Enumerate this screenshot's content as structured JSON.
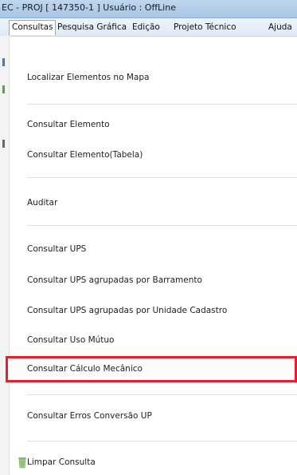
{
  "window": {
    "title": "EC - PROJ [ 147350-1 ] Usuário : OffLine"
  },
  "menubar": {
    "items": [
      {
        "label": "Consultas"
      },
      {
        "label": "Pesquisa Gráfica"
      },
      {
        "label": "Edição"
      },
      {
        "label": "Projeto Técnico"
      },
      {
        "label": "Ajuda"
      }
    ]
  },
  "dropdown": {
    "items": [
      {
        "label": "Localizar Elementos no Mapa"
      },
      {
        "label": "Consultar Elemento"
      },
      {
        "label": "Consultar Elemento(Tabela)"
      },
      {
        "label": "Auditar"
      },
      {
        "label": "Consultar UPS"
      },
      {
        "label": "Consultar UPS agrupadas por Barramento"
      },
      {
        "label": "Consultar UPS agrupadas por Unidade Cadastro"
      },
      {
        "label": "Consultar Uso Mútuo"
      },
      {
        "label": "Consultar Cálculo Mecânico"
      },
      {
        "label": "Consultar Erros Conversão UP"
      },
      {
        "label": "Limpar Consulta"
      }
    ]
  },
  "colors": {
    "highlight_border": "#e0202c",
    "menu_active_border": "#8ea9c8"
  },
  "icons": {
    "limpar": "trash-icon"
  }
}
